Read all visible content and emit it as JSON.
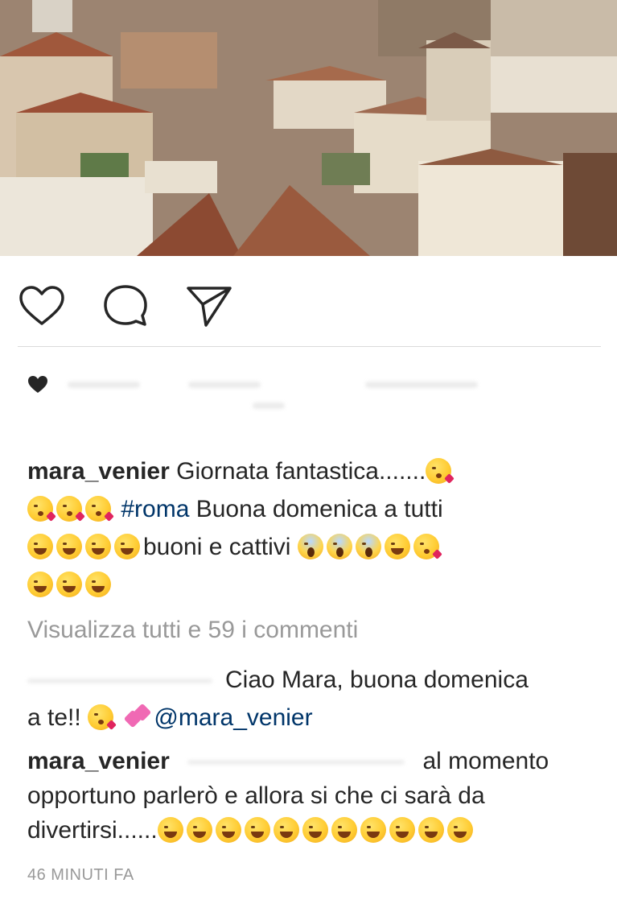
{
  "post": {
    "image": "rooftops-of-rome-photo",
    "actions": {
      "like_icon": "heart-outline-icon",
      "comment_icon": "comment-bubble-icon",
      "share_icon": "paper-plane-icon"
    },
    "likes_icon": "heart-filled-icon"
  },
  "caption": {
    "username": "mara_venier",
    "text_1": "Giornata fantastica.......",
    "hashtag": "#roma",
    "text_2": "Buona domenica a tutti",
    "text_3": "buoni e cattivi"
  },
  "view_all_comments": "Visualizza tutti e 59 i commenti",
  "comments": [
    {
      "text_a": "Ciao Mara, buona domenica",
      "text_b": "a te!!",
      "mention": "@mara_venier"
    },
    {
      "username": "mara_venier",
      "text_a": "al momento",
      "text_b": "opportuno parlerò e allora si che ci sarà da",
      "text_c": "divertirsi......"
    }
  ],
  "timestamp": "46 MINUTI FA",
  "colors": {
    "link": "#003569",
    "muted": "#999999",
    "divider": "#dbdbdb"
  }
}
